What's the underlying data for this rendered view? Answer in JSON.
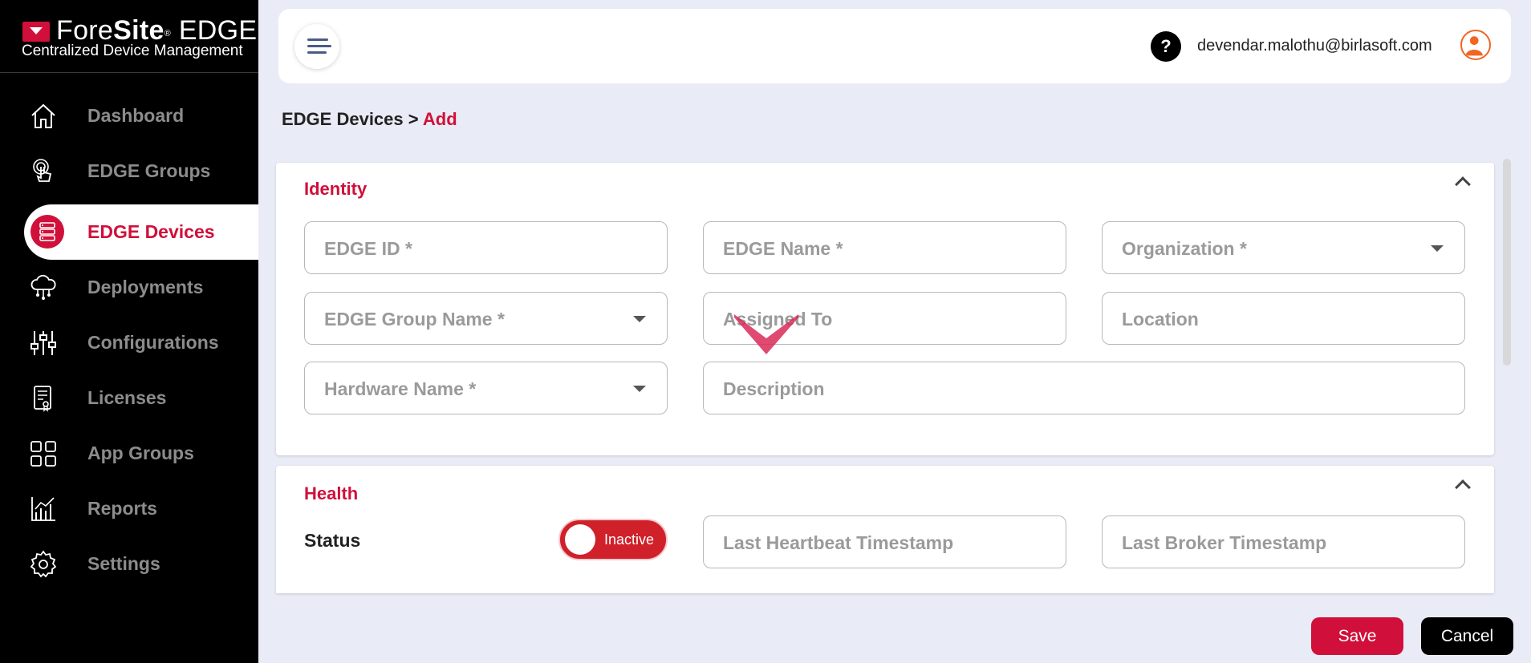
{
  "brand": {
    "title_prefix": "Fore",
    "title_bold": "Site",
    "registered": "®",
    "title_suffix": " EDGE",
    "subtitle": "Centralized Device Management",
    "accent_color": "#d0103a"
  },
  "sidebar": {
    "items": [
      {
        "label": "Dashboard",
        "icon": "home-icon",
        "active": false
      },
      {
        "label": "EDGE Groups",
        "icon": "touch-icon",
        "active": false
      },
      {
        "label": "EDGE Devices",
        "icon": "server-icon",
        "active": true
      },
      {
        "label": "Deployments",
        "icon": "cloud-network-icon",
        "active": false
      },
      {
        "label": "Configurations",
        "icon": "sliders-icon",
        "active": false
      },
      {
        "label": "Licenses",
        "icon": "certificate-icon",
        "active": false
      },
      {
        "label": "App Groups",
        "icon": "grid-icon",
        "active": false
      },
      {
        "label": "Reports",
        "icon": "chart-icon",
        "active": false
      },
      {
        "label": "Settings",
        "icon": "gear-icon",
        "active": false
      }
    ]
  },
  "header": {
    "help": "?",
    "email": "devendar.malothu@birlasoft.com"
  },
  "breadcrumb": {
    "parent": "EDGE Devices",
    "separator": " > ",
    "current": "Add"
  },
  "identity": {
    "title": "Identity",
    "fields": {
      "edge_id": "EDGE ID *",
      "edge_name": "EDGE Name *",
      "organization": "Organization *",
      "edge_group_name": "EDGE Group Name *",
      "assigned_to": "Assigned To",
      "location": "Location",
      "hardware_name": "Hardware Name *",
      "description": "Description"
    }
  },
  "health": {
    "title": "Health",
    "status_label": "Status",
    "status_toggle": "Inactive",
    "fields": {
      "last_heartbeat": "Last Heartbeat Timestamp",
      "last_broker": "Last Broker Timestamp"
    }
  },
  "actions": {
    "save": "Save",
    "cancel": "Cancel"
  }
}
